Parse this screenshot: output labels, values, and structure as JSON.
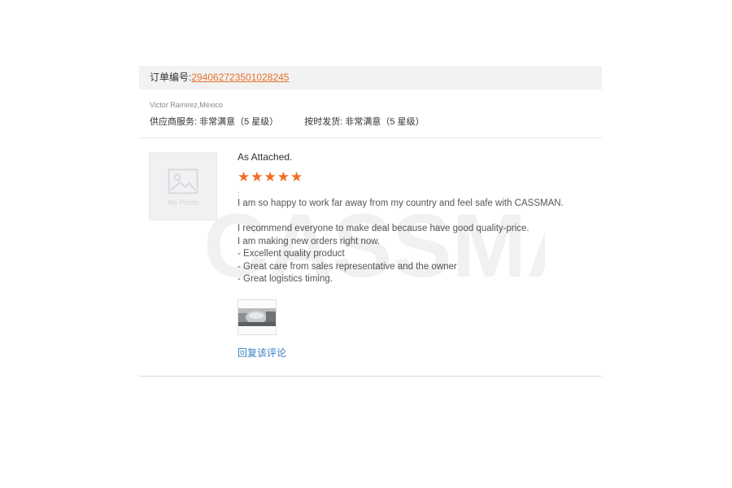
{
  "order": {
    "label": "订单编号:",
    "number": "294062723501028245"
  },
  "buyer": {
    "name": "Victor Ramirez,Mexico",
    "supplier_service": "供应商服务: 非常满意（5 星级）",
    "on_time_delivery": "按时发货: 非常满意（5 星级）"
  },
  "review": {
    "avatar_text": "No Photo",
    "title": "As Attached.",
    "stars": "★★★★★",
    "rating": 5,
    "colon": ":",
    "lines": [
      "I am so happy to work far away from my country and feel safe with CASSMAN.",
      "I recommend everyone to make deal because have good quality-price.",
      "I am making new orders right now.",
      "- Excellent quality product",
      "- Great care from sales representative and the owner",
      "- Great logistics timing."
    ],
    "reply_label": "回复该评论"
  },
  "watermark_text": "CASSMAN",
  "colors": {
    "star": "#f26d21",
    "order_link": "#e8702a",
    "reply_link": "#3b82c4",
    "bar": "#f2f2f2"
  }
}
